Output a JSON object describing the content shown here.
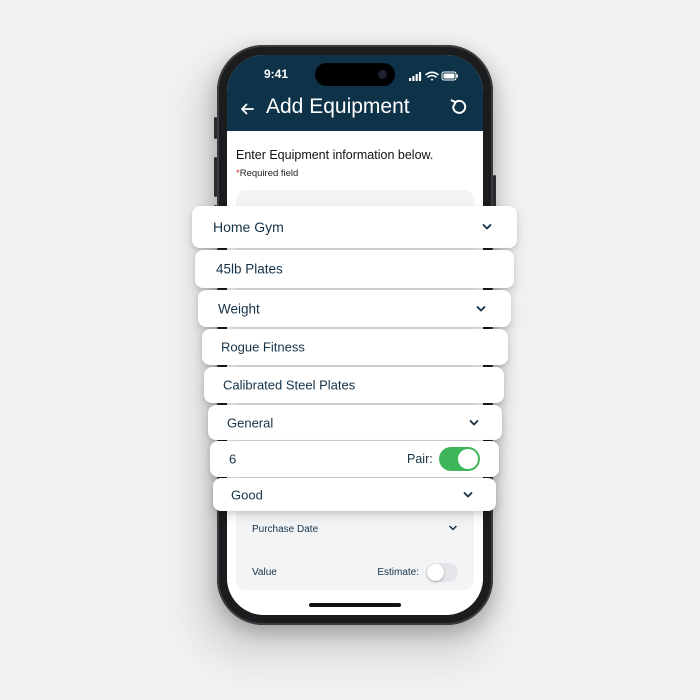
{
  "status_bar": {
    "time": "9:41"
  },
  "header": {
    "title": "Add Equipment"
  },
  "form": {
    "intro": "Enter Equipment information below.",
    "required_star": "*",
    "required_note": "Required field"
  },
  "fields": {
    "location": "Home Gym",
    "name": "45lb Plates",
    "category": "Weight",
    "brand": "Rogue Fitness",
    "model": "Calibrated Steel Plates",
    "type": "General",
    "quantity": "6",
    "pair_label": "Pair:",
    "pair_enabled": true,
    "condition": "Good"
  },
  "under_fields": {
    "purchase_date": "Purchase Date",
    "value": "Value",
    "estimate_label": "Estimate:",
    "estimate_enabled": false
  },
  "icons": {
    "back": "back-arrow-icon",
    "refresh": "refresh-icon",
    "dropdown": "chevron-down-icon",
    "signal": "signal-icon",
    "wifi": "wifi-icon",
    "battery": "battery-icon"
  },
  "colors": {
    "header_bg": "#0e3349",
    "text": "#163247",
    "toggle_on": "#3cb658",
    "required": "#d12a2a"
  }
}
